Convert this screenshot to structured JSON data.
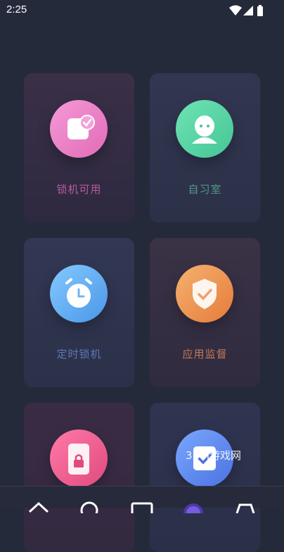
{
  "status_bar": {
    "time": "2:25",
    "icons": [
      "wifi-icon",
      "cell-signal-icon",
      "battery-icon"
    ]
  },
  "cards": [
    {
      "label": "锁机可用",
      "icon": "lock-schedule-icon",
      "accent": "#e26bb7"
    },
    {
      "label": "自习室",
      "icon": "study-avatar-icon",
      "accent": "#46c596"
    },
    {
      "label": "定时锁机",
      "icon": "alarm-clock-icon",
      "accent": "#4b97e8"
    },
    {
      "label": "应用监督",
      "icon": "shield-check-icon",
      "accent": "#e47b3b"
    },
    {
      "label": "",
      "icon": "phone-lock-icon",
      "accent": "#e04a7e"
    },
    {
      "label": "",
      "icon": "checkbox-icon",
      "accent": "#4b71e0"
    }
  ],
  "watermark": "3DM游戏网",
  "bottom_nav": {
    "items": [
      "home-icon",
      "search-icon",
      "window-icon",
      "profile-icon",
      "store-icon"
    ]
  }
}
